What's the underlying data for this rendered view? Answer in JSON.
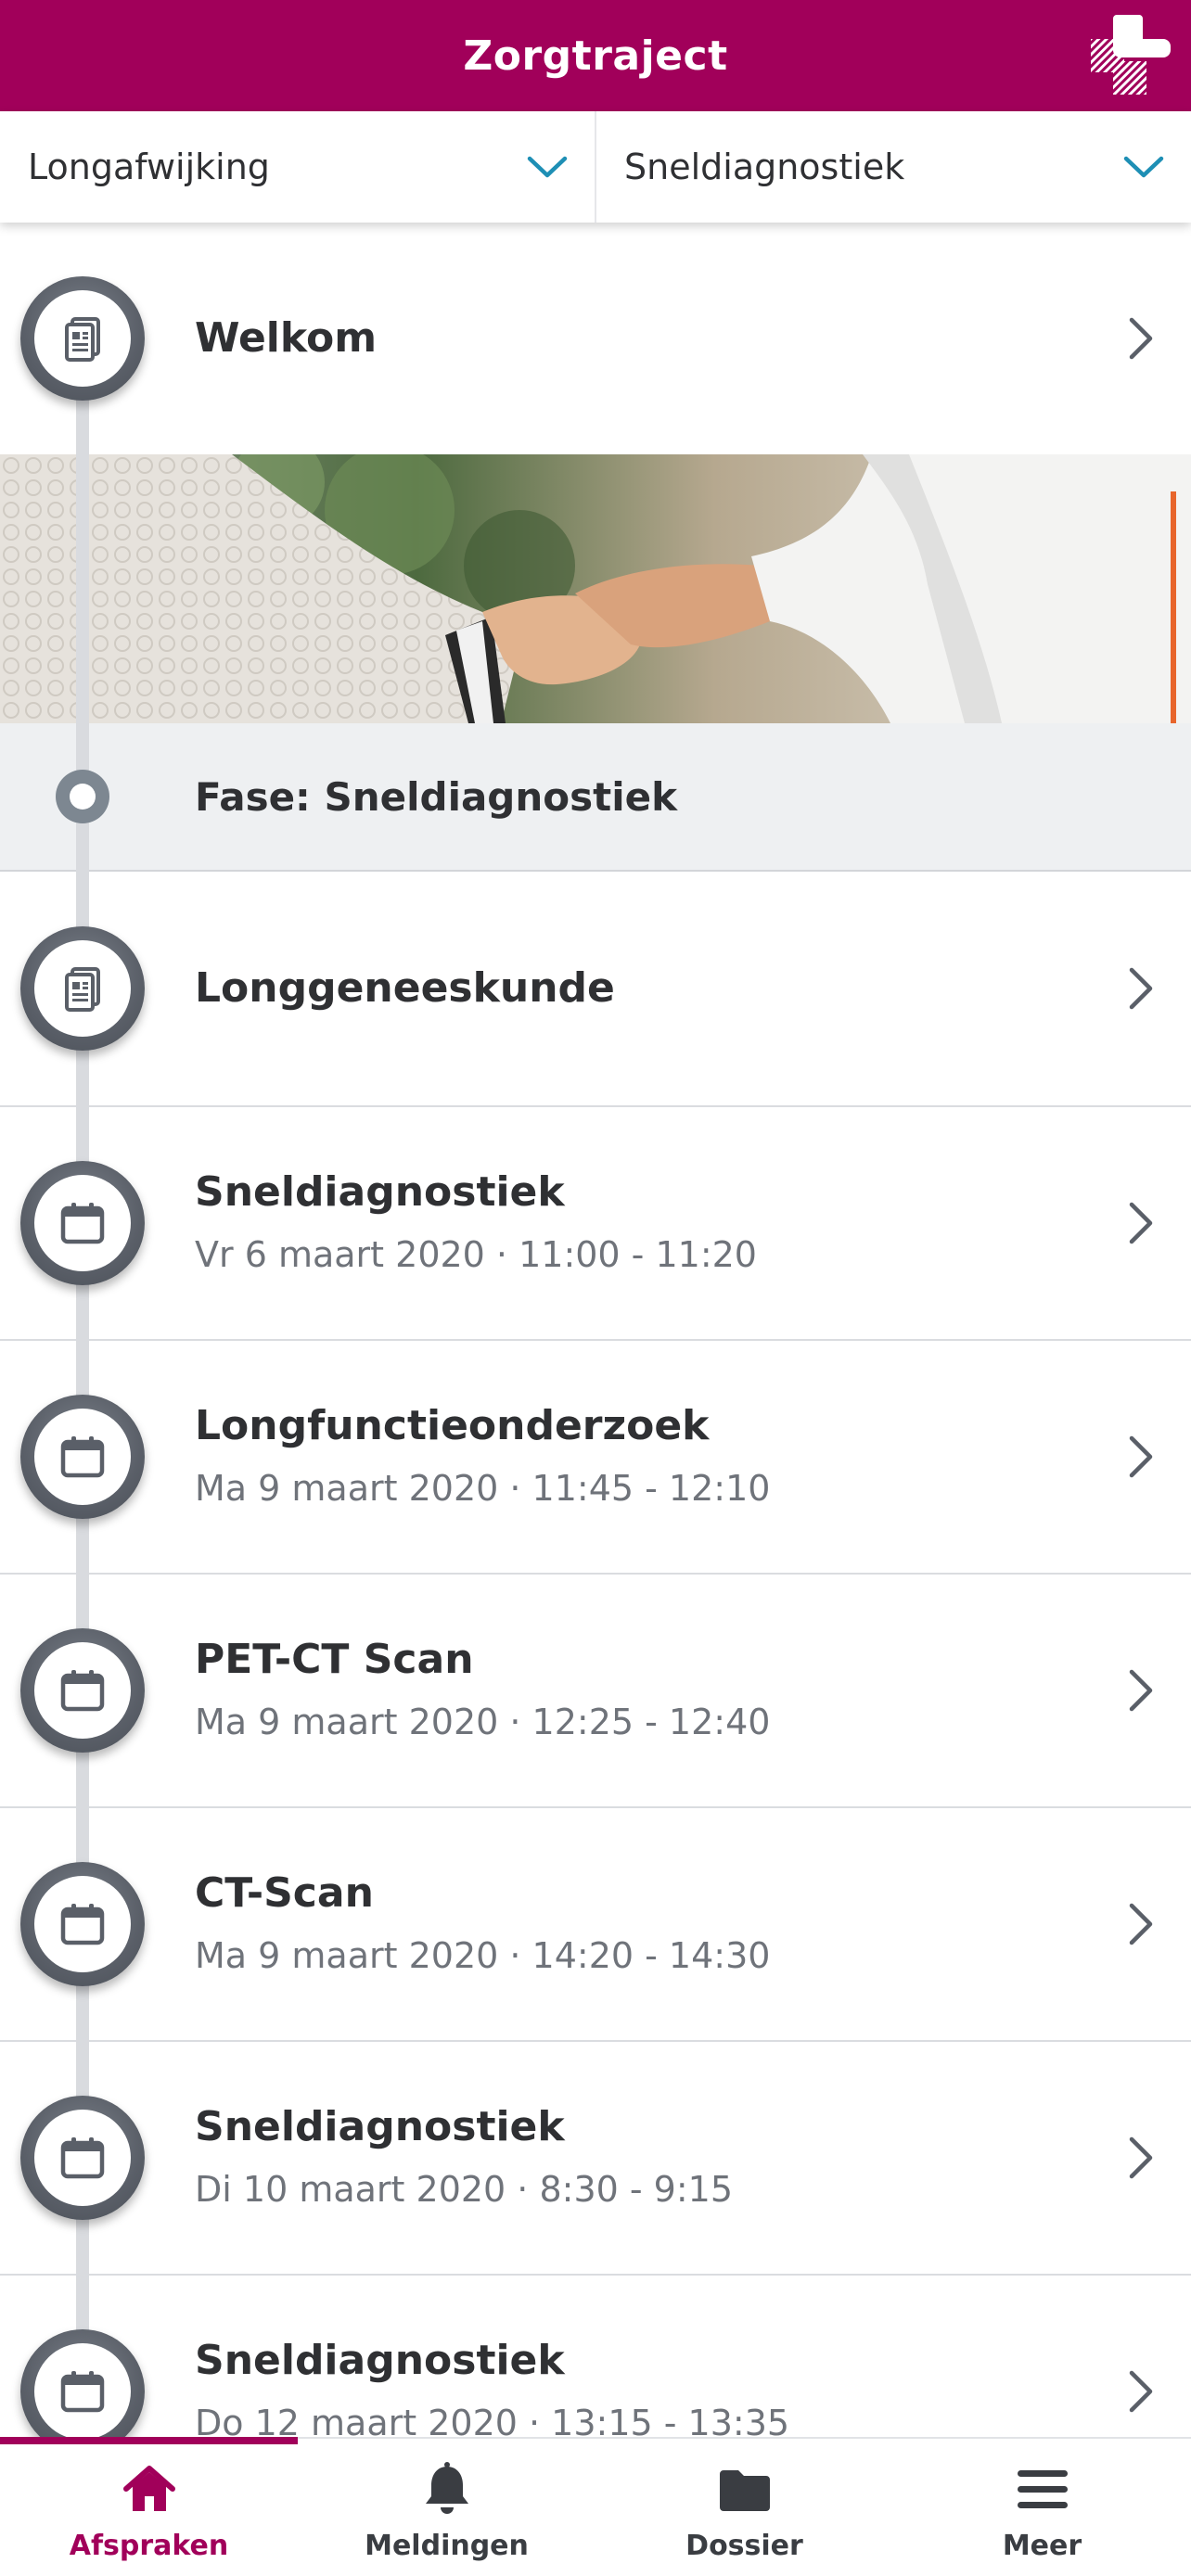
{
  "header": {
    "title": "Zorgtraject",
    "accent_color": "#a1005a",
    "logo_icon": "hospital-cross-logo"
  },
  "filters": {
    "condition": {
      "label": "Longafwijking",
      "icon": "chevron-down-icon"
    },
    "program": {
      "label": "Sneldiagnostiek",
      "icon": "chevron-down-icon"
    }
  },
  "timeline": {
    "welcome": {
      "title": "Welkom",
      "icon": "document-icon"
    },
    "phase": {
      "label": "Fase: Sneldiagnostiek"
    },
    "items": [
      {
        "title": "Longgeneeskunde",
        "subtitle": "",
        "icon": "document-icon"
      },
      {
        "title": "Sneldiagnostiek",
        "subtitle": "Vr 6 maart 2020 · 11:00 - 11:20",
        "icon": "calendar-icon"
      },
      {
        "title": "Longfunctieonderzoek",
        "subtitle": "Ma 9 maart 2020 · 11:45 - 12:10",
        "icon": "calendar-icon"
      },
      {
        "title": "PET-CT Scan",
        "subtitle": "Ma 9 maart 2020 · 12:25 - 12:40",
        "icon": "calendar-icon"
      },
      {
        "title": "CT-Scan",
        "subtitle": "Ma 9 maart 2020 · 14:20 - 14:30",
        "icon": "calendar-icon"
      },
      {
        "title": "Sneldiagnostiek",
        "subtitle": "Di 10 maart 2020 · 8:30 - 9:15",
        "icon": "calendar-icon"
      },
      {
        "title": "Sneldiagnostiek",
        "subtitle": "Do 12 maart 2020 · 13:15 - 13:35",
        "icon": "calendar-icon"
      }
    ]
  },
  "bottom_nav": {
    "items": [
      {
        "label": "Afspraken",
        "icon": "home-icon",
        "active": true
      },
      {
        "label": "Meldingen",
        "icon": "bell-icon",
        "active": false
      },
      {
        "label": "Dossier",
        "icon": "folder-icon",
        "active": false
      },
      {
        "label": "Meer",
        "icon": "menu-icon",
        "active": false
      }
    ]
  }
}
